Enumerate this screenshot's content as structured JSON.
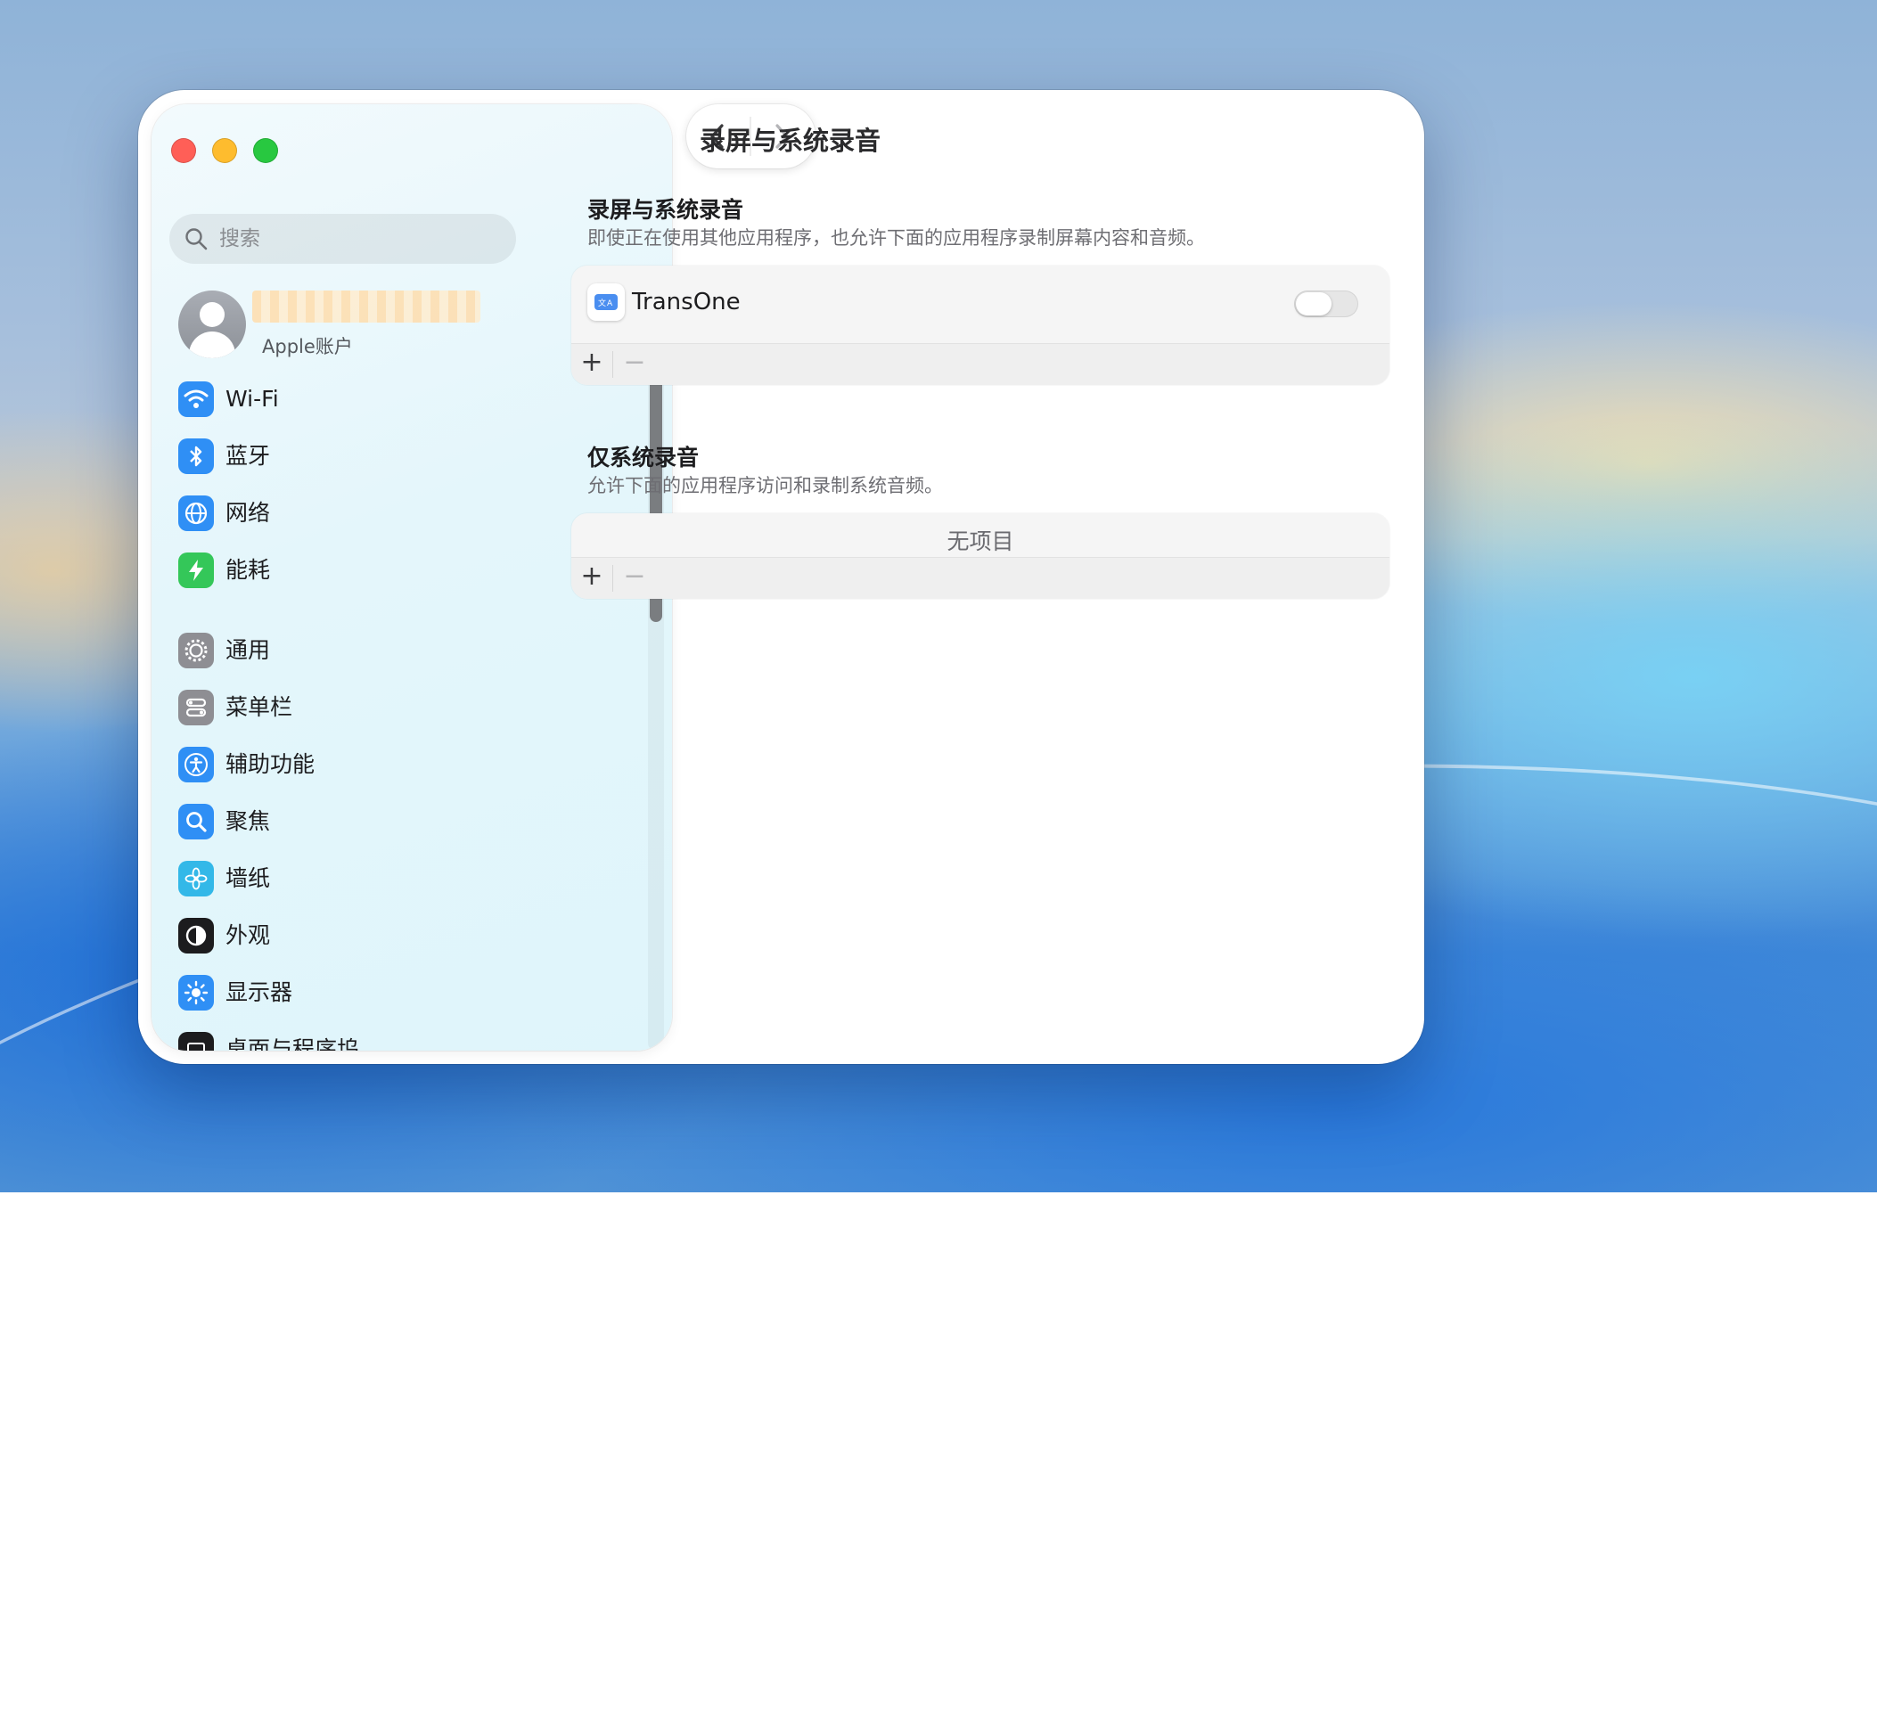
{
  "window": {
    "title": "录屏与系统录音"
  },
  "sidebar": {
    "search": {
      "placeholder": "搜索",
      "icon": "search-icon"
    },
    "account": {
      "subtitle": "Apple账户"
    },
    "items": [
      {
        "label": "Wi-Fi",
        "icon": "wifi-icon",
        "color": "#2f8ff5"
      },
      {
        "label": "蓝牙",
        "icon": "bluetooth-icon",
        "color": "#2f8ff5"
      },
      {
        "label": "网络",
        "icon": "globe-icon",
        "color": "#2f8ff5"
      },
      {
        "label": "能耗",
        "icon": "bolt-icon",
        "color": "#34c759"
      },
      {
        "label": "通用",
        "icon": "gear-icon",
        "color": "#8e8e93"
      },
      {
        "label": "菜单栏",
        "icon": "menubar-icon",
        "color": "#8e8e93"
      },
      {
        "label": "辅助功能",
        "icon": "accessibility-icon",
        "color": "#2f8ff5"
      },
      {
        "label": "聚焦",
        "icon": "magnifier-icon",
        "color": "#2f8ff5"
      },
      {
        "label": "墙纸",
        "icon": "flower-icon",
        "color": "#33b8e8"
      },
      {
        "label": "外观",
        "icon": "appearance-icon",
        "color": "#1c1c1e"
      },
      {
        "label": "显示器",
        "icon": "sun-icon",
        "color": "#2f8ff5"
      },
      {
        "label": "桌面与程序坞",
        "icon": "dock-icon",
        "color": "#1c1c1e"
      }
    ]
  },
  "main": {
    "section1": {
      "title": "录屏与系统录音",
      "description": "即使正在使用其他应用程序，也允许下面的应用程序录制屏幕内容和音频。",
      "apps": [
        {
          "name": "TransOne",
          "enabled": false,
          "icon": "translate-icon"
        }
      ],
      "add_label": "+",
      "remove_label": "−"
    },
    "section2": {
      "title": "仅系统录音",
      "description": "允许下面的应用程序访问和录制系统音频。",
      "empty_label": "无项目",
      "add_label": "+",
      "remove_label": "−"
    }
  }
}
